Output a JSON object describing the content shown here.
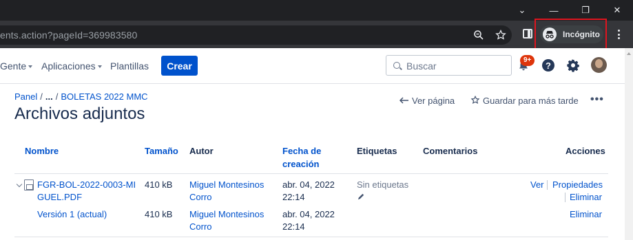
{
  "browser": {
    "url": "ents.action?pageId=369983580",
    "profile_label": "Incógnito",
    "window_controls": {
      "chevron": "⌄",
      "minimize": "—",
      "restore": "❐",
      "close": "✕"
    }
  },
  "header": {
    "nav": {
      "people": "Gente",
      "apps": "Aplicaciones",
      "templates": "Plantillas"
    },
    "create_label": "Crear",
    "search_placeholder": "Buscar",
    "notifications_count": "9+",
    "help_symbol": "?"
  },
  "breadcrumb": {
    "root": "Panel",
    "ellipsis": "...",
    "parent": "BOLETAS 2022 MMC"
  },
  "page": {
    "title": "Archivos adjuntos",
    "view_page": "Ver página",
    "save_later": "Guardar para más tarde",
    "more": "•••"
  },
  "table": {
    "headers": {
      "name": "Nombre",
      "size": "Tamaño",
      "author": "Autor",
      "created_line1": "Fecha de",
      "created_line2": "creación",
      "labels": "Etiquetas",
      "comments": "Comentarios",
      "actions": "Acciones"
    },
    "file": {
      "name_line1": "FGR-BOL-2022-0003-MI",
      "name_line2": "GUEL.PDF",
      "size": "410 kB",
      "author_line1": "Miguel Montesinos",
      "author_line2": "Corro",
      "date_line1": "abr. 04, 2022",
      "date_line2": "22:14",
      "labels": "Sin etiquetas",
      "action_view": "Ver",
      "action_properties": "Propiedades",
      "action_delete": "Eliminar"
    },
    "version": {
      "name": "Versión 1 (actual)",
      "size": "410 kB",
      "author_line1": "Miguel Montesinos",
      "author_line2": "Corro",
      "date_line1": "abr. 04, 2022",
      "date_line2": "22:14",
      "action_delete": "Eliminar"
    }
  },
  "colors": {
    "link": "#0052cc",
    "primary_button": "#0052cc",
    "badge": "#de350b",
    "highlight_box": "#e0141e",
    "chrome_dark": "#202124"
  }
}
